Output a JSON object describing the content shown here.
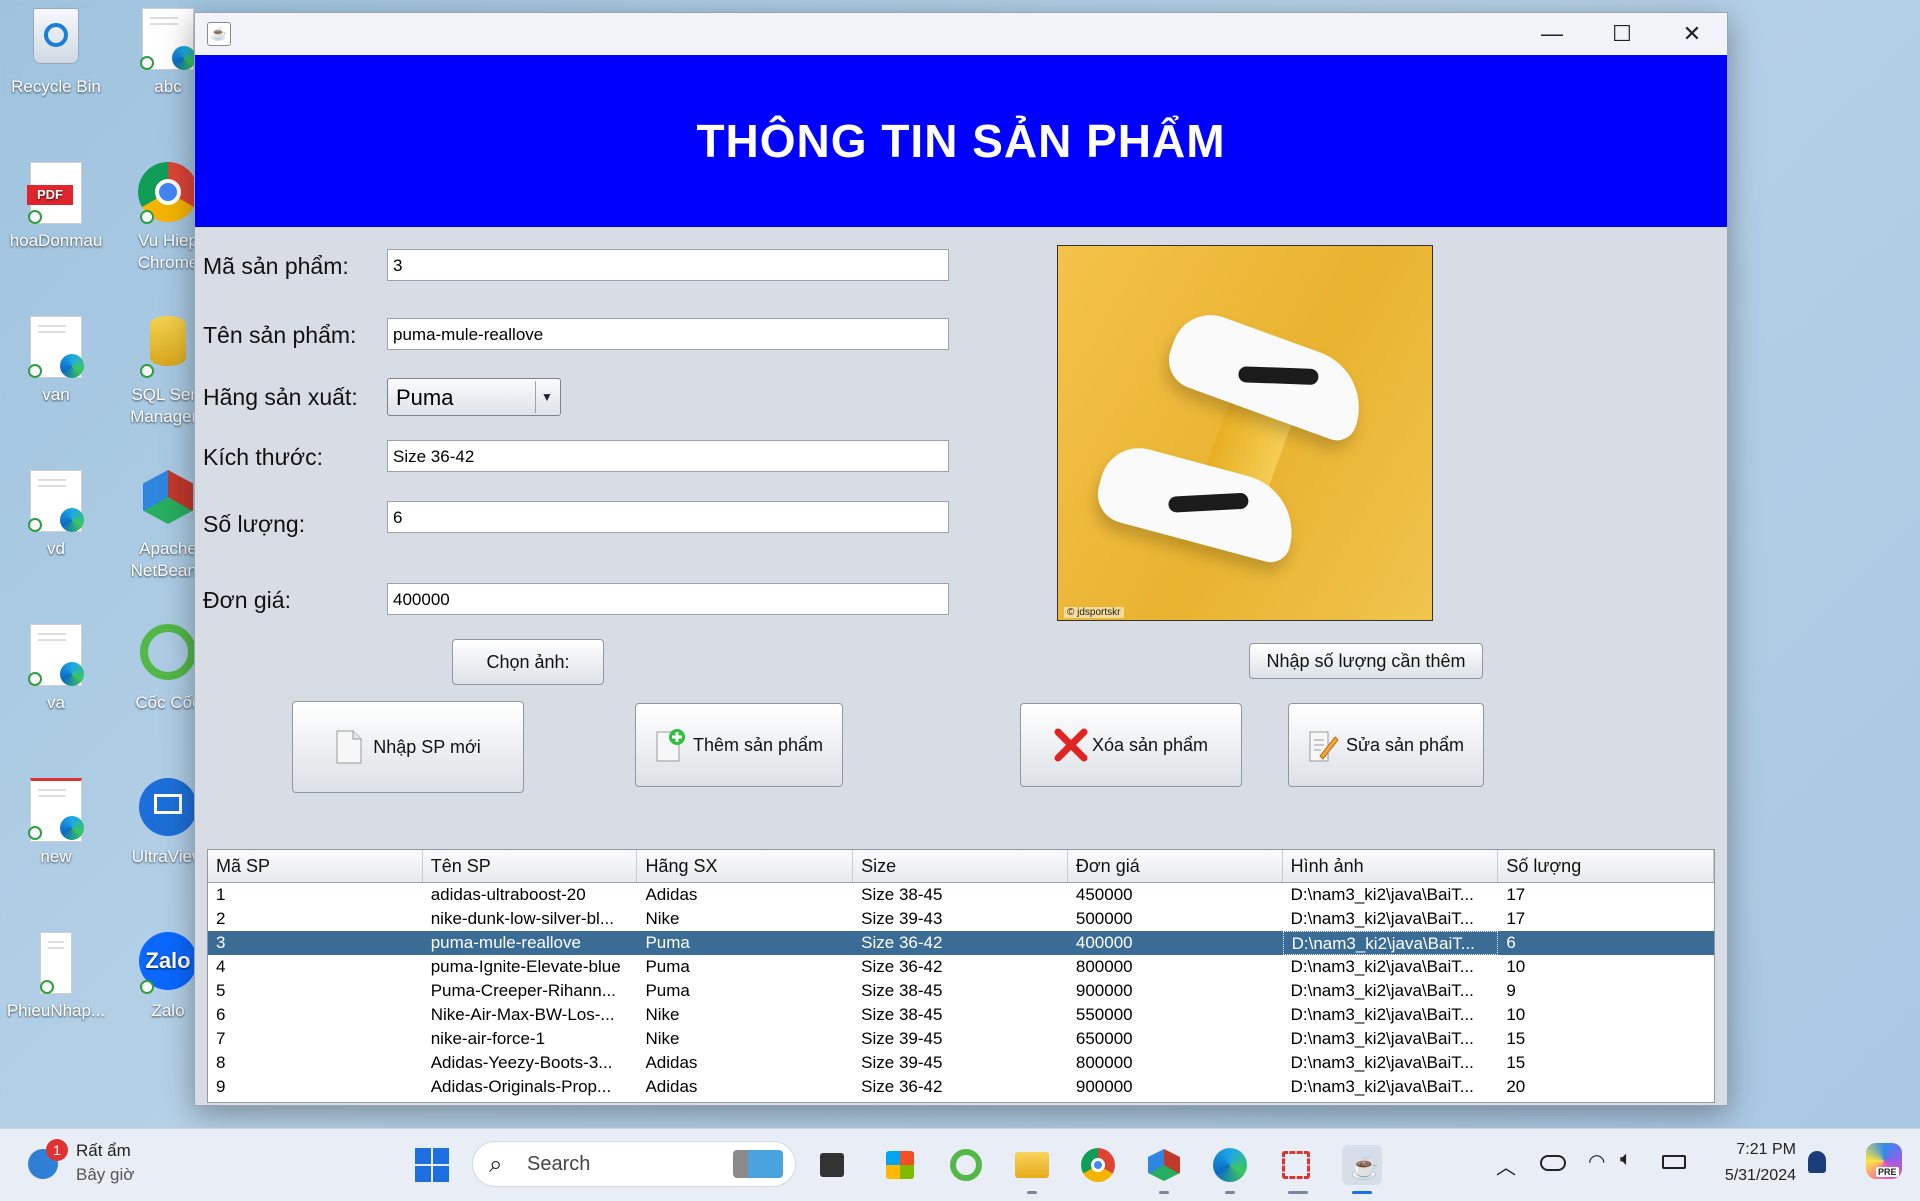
{
  "desktop": {
    "icons": [
      {
        "label": "Recycle Bin",
        "icon": "recycle-bin-icon"
      },
      {
        "label": "abc",
        "icon": "edge-document-icon"
      },
      {
        "label": "hoaDonmau",
        "icon": "pdf-icon"
      },
      {
        "label": "Vu Hiep Chrome",
        "icon": "chrome-icon"
      },
      {
        "label": "van",
        "icon": "edge-document-icon"
      },
      {
        "label": "SQL Serv Managem",
        "icon": "sql-server-icon"
      },
      {
        "label": "vd",
        "icon": "edge-document-icon"
      },
      {
        "label": "Apache NetBeans",
        "icon": "netbeans-icon"
      },
      {
        "label": "va",
        "icon": "edge-document-icon"
      },
      {
        "label": "Cốc Cốc",
        "icon": "coccoc-icon"
      },
      {
        "label": "new",
        "icon": "edge-document-icon"
      },
      {
        "label": "UltraView",
        "icon": "ultraview-icon"
      },
      {
        "label": "PhieuNhap...",
        "icon": "document-icon"
      },
      {
        "label": "Zalo",
        "icon": "zalo-icon"
      }
    ]
  },
  "window": {
    "banner_title": "THÔNG TIN SẢN PHẨM",
    "form": {
      "ma_sp_label": "Mã sản phẩm:",
      "ma_sp_value": "3",
      "ten_sp_label": "Tên sản phẩm:",
      "ten_sp_value": "puma-mule-reallove",
      "hang_label": "Hãng sản xuất:",
      "hang_value": "Puma",
      "kich_thuoc_label": "Kích thước:",
      "kich_thuoc_value": "Size 36-42",
      "so_luong_label": "Số lượng:",
      "so_luong_value": "6",
      "don_gia_label": "Đơn giá:",
      "don_gia_value": "400000"
    },
    "photo_watermark": "© jdsportskr",
    "buttons": {
      "chon_anh": "Chọn ảnh:",
      "nhap_so_luong": "Nhập số lượng cần thêm",
      "nhap_sp_moi": "Nhập SP mới",
      "them_sp": "Thêm sản phẩm",
      "xoa_sp": "Xóa sản phẩm",
      "sua_sp": "Sửa sản phẩm"
    },
    "table": {
      "columns": [
        "Mã SP",
        "Tên SP",
        "Hãng SX",
        "Size",
        "Đơn giá",
        "Hình ảnh",
        "Số lượng"
      ],
      "selected_row": 2,
      "rows": [
        [
          "1",
          "adidas-ultraboost-20",
          "Adidas",
          "Size 38-45",
          "450000",
          "D:\\nam3_ki2\\java\\BaiT...",
          "17"
        ],
        [
          "2",
          "nike-dunk-low-silver-bl...",
          "Nike",
          "Size 39-43",
          "500000",
          "D:\\nam3_ki2\\java\\BaiT...",
          "17"
        ],
        [
          "3",
          "puma-mule-reallove",
          "Puma",
          "Size 36-42",
          "400000",
          "D:\\nam3_ki2\\java\\BaiT...",
          "6"
        ],
        [
          "4",
          "puma-Ignite-Elevate-blue",
          "Puma",
          "Size 36-42",
          "800000",
          "D:\\nam3_ki2\\java\\BaiT...",
          "10"
        ],
        [
          "5",
          "Puma-Creeper-Rihann...",
          "Puma",
          "Size 38-45",
          "900000",
          "D:\\nam3_ki2\\java\\BaiT...",
          "9"
        ],
        [
          "6",
          "Nike-Air-Max-BW-Los-...",
          "Nike",
          "Size 38-45",
          "550000",
          "D:\\nam3_ki2\\java\\BaiT...",
          "10"
        ],
        [
          "7",
          "nike-air-force-1",
          "Nike",
          "Size 39-45",
          "650000",
          "D:\\nam3_ki2\\java\\BaiT...",
          "15"
        ],
        [
          "8",
          "Adidas-Yeezy-Boots-3...",
          "Adidas",
          "Size 39-45",
          "800000",
          "D:\\nam3_ki2\\java\\BaiT...",
          "15"
        ],
        [
          "9",
          "Adidas-Originals-Prop...",
          "Adidas",
          "Size 36-42",
          "900000",
          "D:\\nam3_ki2\\java\\BaiT...",
          "20"
        ]
      ]
    },
    "colors": {
      "banner": "#0000ff",
      "selection": "#3b6c95"
    }
  },
  "taskbar": {
    "weather_title": "Rất ẩm",
    "weather_sub": "Bây giờ",
    "weather_badge": "1",
    "search_placeholder": "Search",
    "time": "7:21 PM",
    "date": "5/31/2024",
    "copilot_badge": "PRE"
  }
}
